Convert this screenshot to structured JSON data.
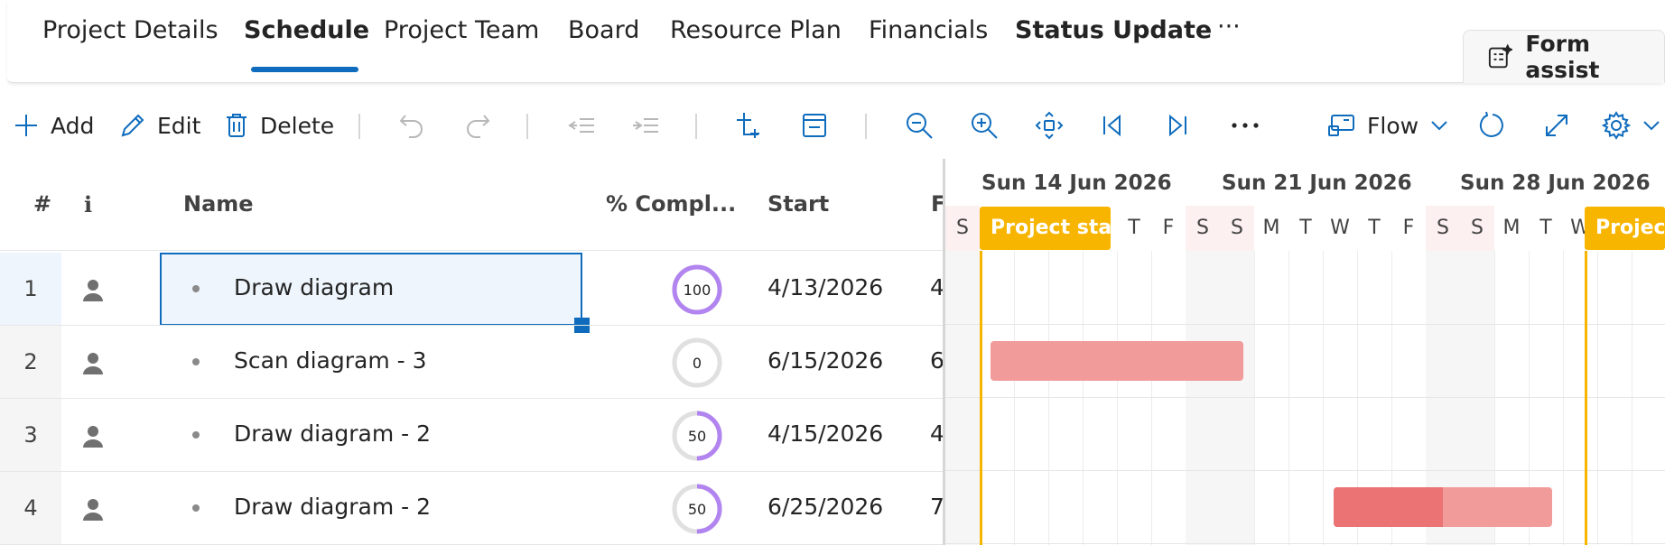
{
  "tabs": [
    {
      "label": "Project Details",
      "active": false
    },
    {
      "label": "Schedule",
      "active": true
    },
    {
      "label": "Project Team",
      "active": false
    },
    {
      "label": "Board",
      "active": false
    },
    {
      "label": "Resource Plan",
      "active": false
    },
    {
      "label": "Financials",
      "active": false
    },
    {
      "label": "Status Update",
      "active": false
    },
    {
      "label": "···",
      "active": false
    }
  ],
  "form_assist": {
    "label": "Form assist",
    "icon": "form-sparkle-icon"
  },
  "toolbar": {
    "add": "Add",
    "edit": "Edit",
    "delete": "Delete",
    "flow": "Flow"
  },
  "grid": {
    "columns": [
      "#",
      "i",
      "Name",
      "% Compl...",
      "Start",
      "F"
    ],
    "rows": [
      {
        "num": "1",
        "name": "Draw diagram",
        "pct": 100,
        "start": "4/13/2026",
        "finish": "4"
      },
      {
        "num": "2",
        "name": "Scan diagram - 3",
        "pct": 0,
        "start": "6/15/2026",
        "finish": "6"
      },
      {
        "num": "3",
        "name": "Draw diagram - 2",
        "pct": 50,
        "start": "4/15/2026",
        "finish": "4"
      },
      {
        "num": "4",
        "name": "Draw diagram - 2",
        "pct": 50,
        "start": "6/25/2026",
        "finish": "7"
      }
    ]
  },
  "gantt": {
    "weeks": [
      "Sun 14 Jun 2026",
      "Sun 21 Jun 2026",
      "Sun 28 Jun 2026"
    ],
    "days": [
      "S",
      "S",
      "M",
      "T",
      "W",
      "T",
      "F",
      "S",
      "S",
      "M",
      "T",
      "W",
      "T",
      "F",
      "S",
      "S",
      "M",
      "T",
      "W",
      "T",
      "F",
      "S"
    ],
    "milestones": [
      "Project start",
      "Project"
    ],
    "colors": {
      "milestone": "#f7b500",
      "bar": "#f29b9b",
      "bar_done": "#ec7373",
      "accent": "#0f6cbd",
      "ring": "#b184ef"
    }
  }
}
